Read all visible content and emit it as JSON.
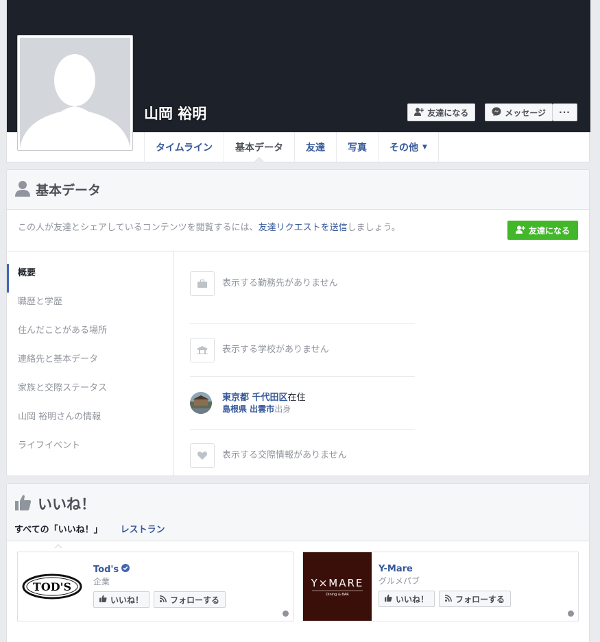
{
  "profile": {
    "name": "山岡 裕明",
    "add_friend_label": "友達になる",
    "message_label": "メッセージ",
    "more_label": "···"
  },
  "tabs": [
    {
      "label": "タイムライン"
    },
    {
      "label": "基本データ"
    },
    {
      "label": "友達"
    },
    {
      "label": "写真"
    },
    {
      "label": "その他"
    }
  ],
  "about": {
    "title": "基本データ",
    "request_prefix": "この人が友達とシェアしているコンテンツを閲覧するには、",
    "request_link": "友達リクエストを送信",
    "request_suffix": "しましょう。",
    "add_friend_label": "友達になる",
    "nav": [
      "概要",
      "職歴と学歴",
      "住んだことがある場所",
      "連絡先と基本データ",
      "家族と交際ステータス",
      "山岡 裕明さんの情報",
      "ライフイベント"
    ],
    "no_work": "表示する勤務先がありません",
    "no_school": "表示する学校がありません",
    "place": {
      "current_city": "東京都 千代田区",
      "current_suffix": "在住",
      "hometown": "島根県 出雲市",
      "hometown_suffix": "出身"
    },
    "no_relationship": "表示する交際情報がありません"
  },
  "likes": {
    "title": "いいね！",
    "tabs": [
      "すべての「いいね！」",
      "レストラン"
    ],
    "pages": [
      {
        "name": "Tod's",
        "category": "企業",
        "logo_text": "TOD'S",
        "verified": true
      },
      {
        "name": "Y-Mare",
        "category": "グルメパブ",
        "logo_text": "Y×MARE",
        "logo_sub": "Dining & BAR",
        "verified": false
      }
    ],
    "like_label": "いいね！",
    "follow_label": "フォローする"
  },
  "colors": {
    "cover": "#1d2129",
    "link": "#365899",
    "green": "#42b72a",
    "ymare_bg": "#3a0f0a"
  }
}
